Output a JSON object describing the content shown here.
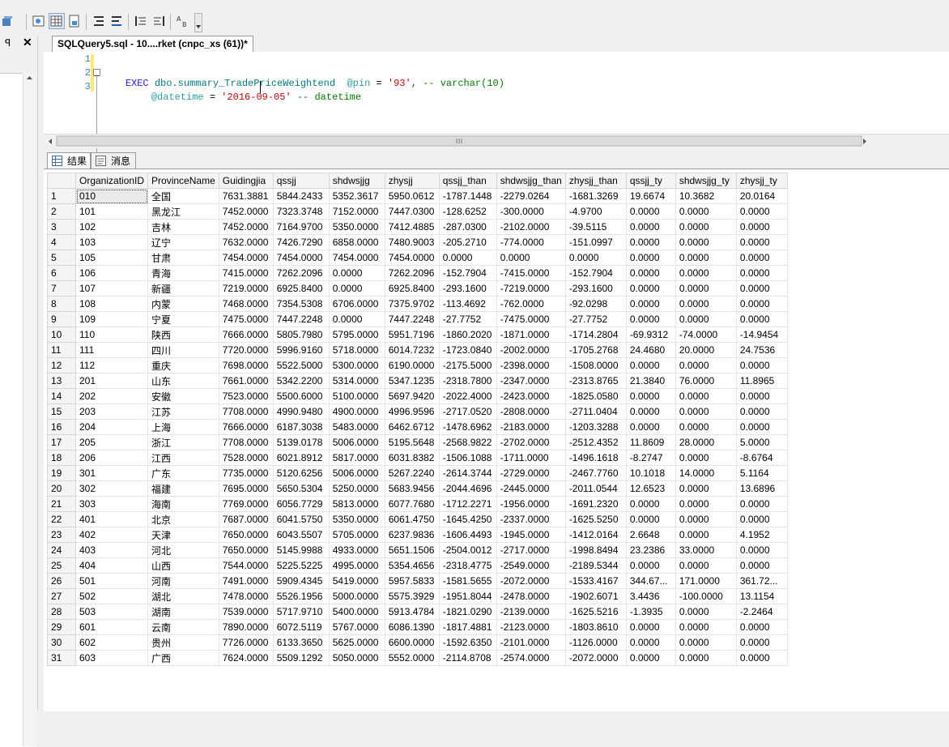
{
  "toolbar": {
    "buttons": [
      "query-options-icon",
      "results-to-grid-icon",
      "results-to-file-icon",
      "comment-icon",
      "uncomment-icon",
      "decrease-indent-icon",
      "increase-indent-icon",
      "specify-values-icon"
    ]
  },
  "left_pane": {
    "pin_glyph": "ꟼ",
    "close_glyph": "✕"
  },
  "document_tab": {
    "title": "SQLQuery5.sql - 10....rket (cnpc_xs (61))*"
  },
  "editor": {
    "line_numbers": [
      "1",
      "2",
      "3"
    ],
    "line2": {
      "kw": "EXEC",
      "proc": "dbo.summary_TradePriceWeightend",
      "param": "@pin",
      "eq": " = ",
      "val": "'93'",
      "rest": ", -- varchar(10)"
    },
    "line3": {
      "param": "@datetime",
      "eq": " = ",
      "val": "'2016-09-05'",
      "rest": " -- datetime"
    }
  },
  "results_tabs": {
    "results": "结果",
    "messages": "消息"
  },
  "grid": {
    "columns": [
      "OrganizationID",
      "ProvinceName",
      "Guidingjia",
      "qssjj",
      "shdwsjjg",
      "zhysjj",
      "qssjj_than",
      "shdwsjjg_than",
      "zhysjj_than",
      "qssjj_ty",
      "shdwsjjg_ty",
      "zhysjj_ty"
    ],
    "rows": [
      [
        "1",
        "010",
        "全国",
        "7631.3881",
        "5844.2433",
        "5352.3617",
        "5950.0612",
        "-1787.1448",
        "-2279.0264",
        "-1681.3269",
        "19.6674",
        "10.3682",
        "20.0164"
      ],
      [
        "2",
        "101",
        "黑龙江",
        "7452.0000",
        "7323.3748",
        "7152.0000",
        "7447.0300",
        "-128.6252",
        "-300.0000",
        "-4.9700",
        "0.0000",
        "0.0000",
        "0.0000"
      ],
      [
        "3",
        "102",
        "吉林",
        "7452.0000",
        "7164.9700",
        "5350.0000",
        "7412.4885",
        "-287.0300",
        "-2102.0000",
        "-39.5115",
        "0.0000",
        "0.0000",
        "0.0000"
      ],
      [
        "4",
        "103",
        "辽宁",
        "7632.0000",
        "7426.7290",
        "6858.0000",
        "7480.9003",
        "-205.2710",
        "-774.0000",
        "-151.0997",
        "0.0000",
        "0.0000",
        "0.0000"
      ],
      [
        "5",
        "105",
        "甘肃",
        "7454.0000",
        "7454.0000",
        "7454.0000",
        "7454.0000",
        "0.0000",
        "0.0000",
        "0.0000",
        "0.0000",
        "0.0000",
        "0.0000"
      ],
      [
        "6",
        "106",
        "青海",
        "7415.0000",
        "7262.2096",
        "0.0000",
        "7262.2096",
        "-152.7904",
        "-7415.0000",
        "-152.7904",
        "0.0000",
        "0.0000",
        "0.0000"
      ],
      [
        "7",
        "107",
        "新疆",
        "7219.0000",
        "6925.8400",
        "0.0000",
        "6925.8400",
        "-293.1600",
        "-7219.0000",
        "-293.1600",
        "0.0000",
        "0.0000",
        "0.0000"
      ],
      [
        "8",
        "108",
        "内蒙",
        "7468.0000",
        "7354.5308",
        "6706.0000",
        "7375.9702",
        "-113.4692",
        "-762.0000",
        "-92.0298",
        "0.0000",
        "0.0000",
        "0.0000"
      ],
      [
        "9",
        "109",
        "宁夏",
        "7475.0000",
        "7447.2248",
        "0.0000",
        "7447.2248",
        "-27.7752",
        "-7475.0000",
        "-27.7752",
        "0.0000",
        "0.0000",
        "0.0000"
      ],
      [
        "10",
        "110",
        "陕西",
        "7666.0000",
        "5805.7980",
        "5795.0000",
        "5951.7196",
        "-1860.2020",
        "-1871.0000",
        "-1714.2804",
        "-69.9312",
        "-74.0000",
        "-14.9454"
      ],
      [
        "11",
        "111",
        "四川",
        "7720.0000",
        "5996.9160",
        "5718.0000",
        "6014.7232",
        "-1723.0840",
        "-2002.0000",
        "-1705.2768",
        "24.4680",
        "20.0000",
        "24.7536"
      ],
      [
        "12",
        "112",
        "重庆",
        "7698.0000",
        "5522.5000",
        "5300.0000",
        "6190.0000",
        "-2175.5000",
        "-2398.0000",
        "-1508.0000",
        "0.0000",
        "0.0000",
        "0.0000"
      ],
      [
        "13",
        "201",
        "山东",
        "7661.0000",
        "5342.2200",
        "5314.0000",
        "5347.1235",
        "-2318.7800",
        "-2347.0000",
        "-2313.8765",
        "21.3840",
        "76.0000",
        "11.8965"
      ],
      [
        "14",
        "202",
        "安徽",
        "7523.0000",
        "5500.6000",
        "5100.0000",
        "5697.9420",
        "-2022.4000",
        "-2423.0000",
        "-1825.0580",
        "0.0000",
        "0.0000",
        "0.0000"
      ],
      [
        "15",
        "203",
        "江苏",
        "7708.0000",
        "4990.9480",
        "4900.0000",
        "4996.9596",
        "-2717.0520",
        "-2808.0000",
        "-2711.0404",
        "0.0000",
        "0.0000",
        "0.0000"
      ],
      [
        "16",
        "204",
        "上海",
        "7666.0000",
        "6187.3038",
        "5483.0000",
        "6462.6712",
        "-1478.6962",
        "-2183.0000",
        "-1203.3288",
        "0.0000",
        "0.0000",
        "0.0000"
      ],
      [
        "17",
        "205",
        "浙江",
        "7708.0000",
        "5139.0178",
        "5006.0000",
        "5195.5648",
        "-2568.9822",
        "-2702.0000",
        "-2512.4352",
        "11.8609",
        "28.0000",
        "5.0000"
      ],
      [
        "18",
        "206",
        "江西",
        "7528.0000",
        "6021.8912",
        "5817.0000",
        "6031.8382",
        "-1506.1088",
        "-1711.0000",
        "-1496.1618",
        "-8.2747",
        "0.0000",
        "-8.6764"
      ],
      [
        "19",
        "301",
        "广东",
        "7735.0000",
        "5120.6256",
        "5006.0000",
        "5267.2240",
        "-2614.3744",
        "-2729.0000",
        "-2467.7760",
        "10.1018",
        "14.0000",
        "5.1164"
      ],
      [
        "20",
        "302",
        "福建",
        "7695.0000",
        "5650.5304",
        "5250.0000",
        "5683.9456",
        "-2044.4696",
        "-2445.0000",
        "-2011.0544",
        "12.6523",
        "0.0000",
        "13.6896"
      ],
      [
        "21",
        "303",
        "海南",
        "7769.0000",
        "6056.7729",
        "5813.0000",
        "6077.7680",
        "-1712.2271",
        "-1956.0000",
        "-1691.2320",
        "0.0000",
        "0.0000",
        "0.0000"
      ],
      [
        "22",
        "401",
        "北京",
        "7687.0000",
        "6041.5750",
        "5350.0000",
        "6061.4750",
        "-1645.4250",
        "-2337.0000",
        "-1625.5250",
        "0.0000",
        "0.0000",
        "0.0000"
      ],
      [
        "23",
        "402",
        "天津",
        "7650.0000",
        "6043.5507",
        "5705.0000",
        "6237.9836",
        "-1606.4493",
        "-1945.0000",
        "-1412.0164",
        "2.6648",
        "0.0000",
        "4.1952"
      ],
      [
        "24",
        "403",
        "河北",
        "7650.0000",
        "5145.9988",
        "4933.0000",
        "5651.1506",
        "-2504.0012",
        "-2717.0000",
        "-1998.8494",
        "23.2386",
        "33.0000",
        "0.0000"
      ],
      [
        "25",
        "404",
        "山西",
        "7544.0000",
        "5225.5225",
        "4995.0000",
        "5354.4656",
        "-2318.4775",
        "-2549.0000",
        "-2189.5344",
        "0.0000",
        "0.0000",
        "0.0000"
      ],
      [
        "26",
        "501",
        "河南",
        "7491.0000",
        "5909.4345",
        "5419.0000",
        "5957.5833",
        "-1581.5655",
        "-2072.0000",
        "-1533.4167",
        "344.67...",
        "171.0000",
        "361.72..."
      ],
      [
        "27",
        "502",
        "湖北",
        "7478.0000",
        "5526.1956",
        "5000.0000",
        "5575.3929",
        "-1951.8044",
        "-2478.0000",
        "-1902.6071",
        "3.4436",
        "-100.0000",
        "13.1154"
      ],
      [
        "28",
        "503",
        "湖南",
        "7539.0000",
        "5717.9710",
        "5400.0000",
        "5913.4784",
        "-1821.0290",
        "-2139.0000",
        "-1625.5216",
        "-1.3935",
        "0.0000",
        "-2.2464"
      ],
      [
        "29",
        "601",
        "云南",
        "7890.0000",
        "6072.5119",
        "5767.0000",
        "6086.1390",
        "-1817.4881",
        "-2123.0000",
        "-1803.8610",
        "0.0000",
        "0.0000",
        "0.0000"
      ],
      [
        "30",
        "602",
        "贵州",
        "7726.0000",
        "6133.3650",
        "5625.0000",
        "6600.0000",
        "-1592.6350",
        "-2101.0000",
        "-1126.0000",
        "0.0000",
        "0.0000",
        "0.0000"
      ],
      [
        "31",
        "603",
        "广西",
        "7624.0000",
        "5509.1292",
        "5050.0000",
        "5552.0000",
        "-2114.8708",
        "-2574.0000",
        "-2072.0000",
        "0.0000",
        "0.0000",
        "0.0000"
      ]
    ]
  }
}
